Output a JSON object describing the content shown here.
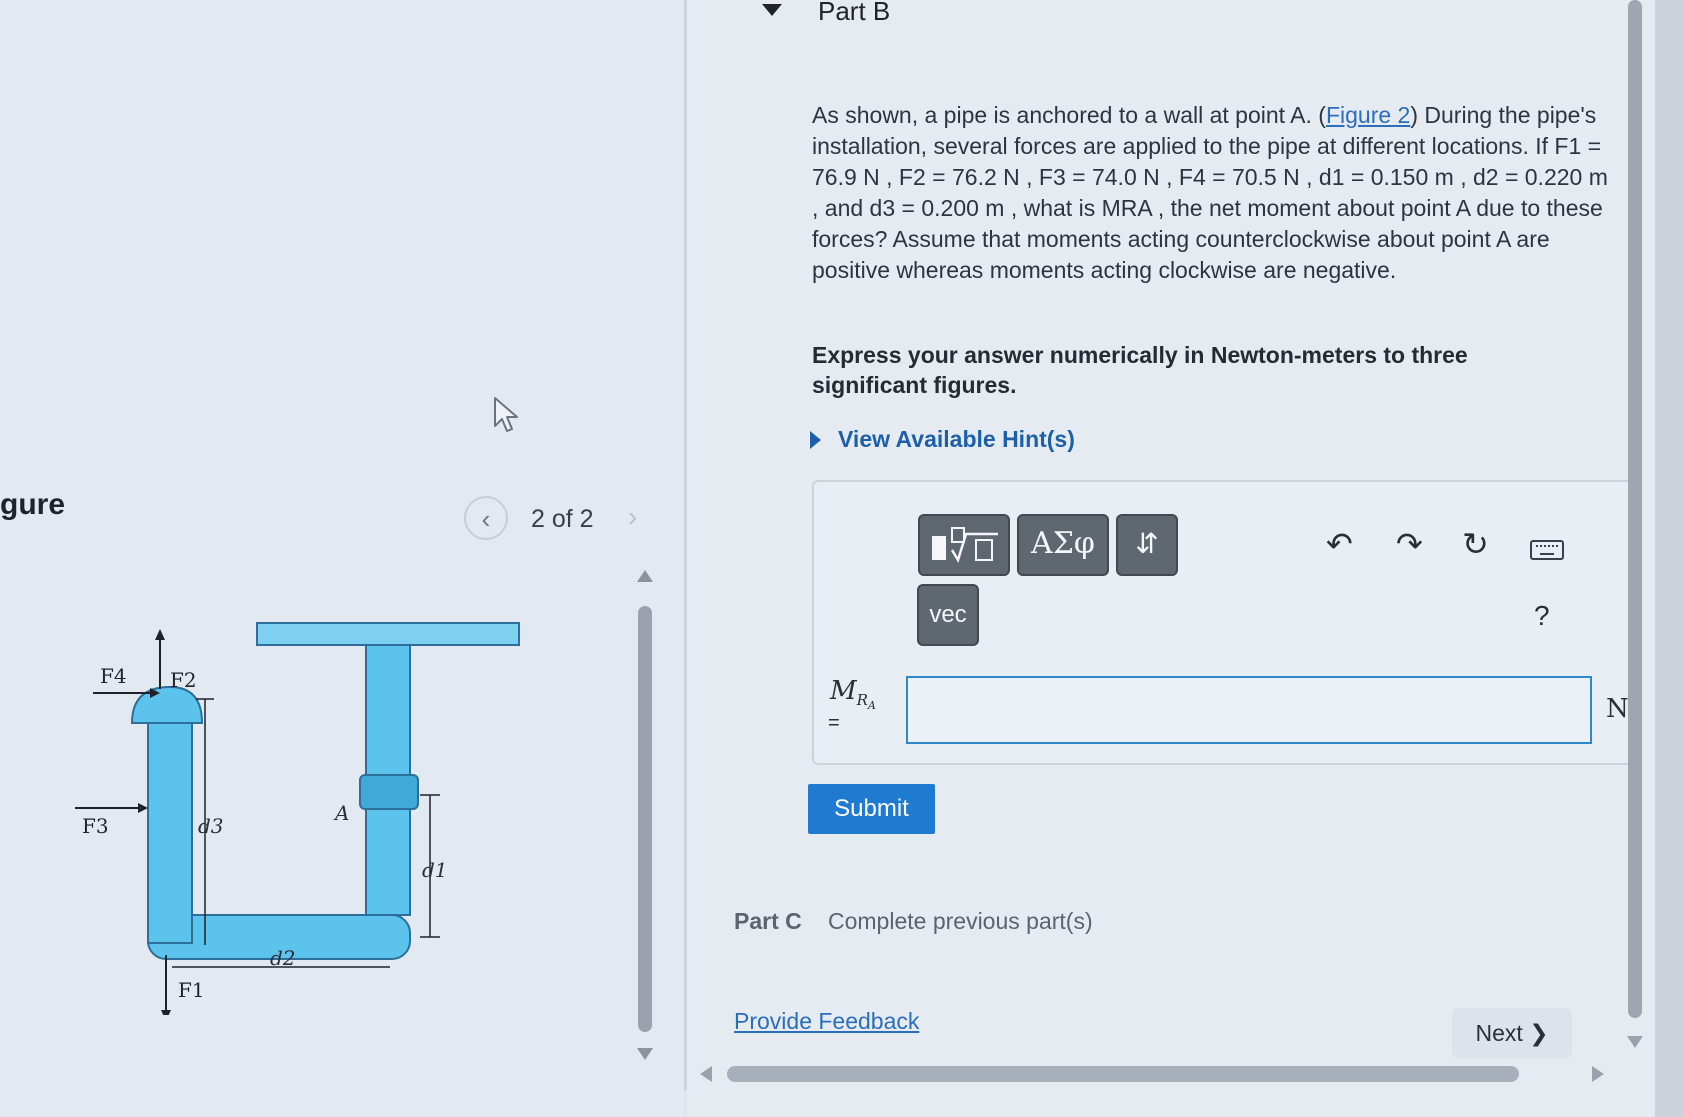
{
  "figure": {
    "heading": "gure",
    "pager": {
      "text": "2 of 2",
      "prev_icon": "‹",
      "next_icon": "›"
    },
    "labels": {
      "F4": "F4",
      "F2": "F2",
      "F3": "F3",
      "F1": "F1",
      "d3": "d3",
      "d2": "d2",
      "d1": "d1",
      "A": "A"
    }
  },
  "part_b": {
    "title": "Part B",
    "problem": {
      "pre_link": "As shown, a pipe is anchored to a wall at point A. (",
      "link": "Figure 2",
      "post_link": ") During the pipe's installation, several forces are applied to the pipe at different locations. If F1 = 76.9 N , F2 = 76.2 N , F3 = 74.0 N , F4 = 70.5 N , d1 = 0.150 m , d2 = 0.220 m , and d3 = 0.200 m , what is MRA , the net moment about point A due to these forces? Assume that moments acting counterclockwise about point A are positive whereas moments acting clockwise are negative."
    },
    "instruction": "Express your answer numerically in Newton-meters to three significant figures.",
    "hint_label": "View Available Hint(s)",
    "toolbar": {
      "greek_label": "ΑΣφ",
      "sort_label": "⇵",
      "vec_label": "vec",
      "undo": "↶",
      "redo": "↷",
      "reset": "↻",
      "help": "?"
    },
    "answer": {
      "var_main": "M",
      "var_sub": "R",
      "var_subsub": "A",
      "equals": "=",
      "value": "",
      "unit": "N"
    },
    "submit_label": "Submit"
  },
  "part_c": {
    "title": "Part C",
    "status": "Complete previous part(s)"
  },
  "footer": {
    "feedback_label": "Provide Feedback",
    "next_label": "Next ❯"
  }
}
